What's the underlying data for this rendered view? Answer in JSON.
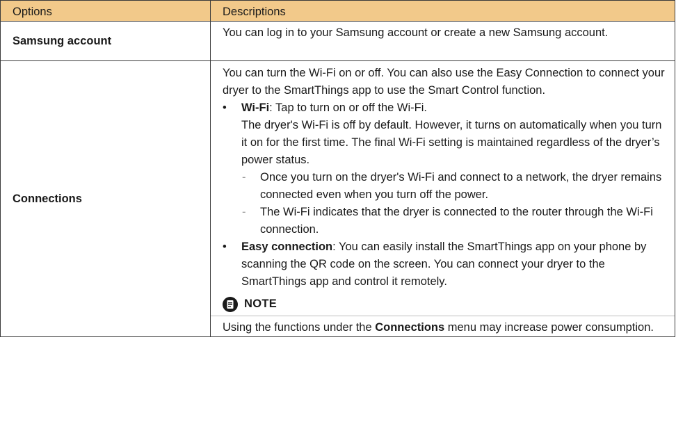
{
  "header": {
    "options": "Options",
    "descriptions": "Descriptions"
  },
  "rows": [
    {
      "option": "Samsung account",
      "description": "You can log in to your Samsung account or create a new Samsung account."
    },
    {
      "option": "Connections",
      "intro": "You can turn the Wi-Fi on or off. You can also use the Easy Connection to connect your dryer to the SmartThings app to use the Smart Control function.",
      "bullets": [
        {
          "marker": "•",
          "term": "Wi-Fi",
          "text": ": Tap to turn on or off the Wi-Fi.",
          "extra": "The dryer's Wi-Fi is off by default. However, it turns on automatically when you turn it on for the first time. The final Wi-Fi setting is maintained regardless of the dryer’s power status.",
          "subitems": [
            {
              "marker": "-",
              "text": "Once you turn on the dryer's Wi-Fi and connect to a network, the dryer remains connected even when you turn off the power."
            },
            {
              "marker": "-",
              "text": "The Wi-Fi indicates that the dryer is connected to the router through the Wi-Fi connection."
            }
          ]
        },
        {
          "marker": "•",
          "term": "Easy connection",
          "text": ": You can easily install the SmartThings app on your phone by scanning the QR code on the screen. You can connect your dryer to the SmartThings app and control it remotely."
        }
      ],
      "note": {
        "icon": "note-icon",
        "title": "NOTE",
        "text_before": "Using the functions under the ",
        "term": "Connections",
        "text_after": " menu may increase power consumption."
      }
    }
  ],
  "colors": {
    "header_bg": "#f2c98a",
    "border": "#3a3a3a",
    "dash": "#9a9a9a"
  }
}
